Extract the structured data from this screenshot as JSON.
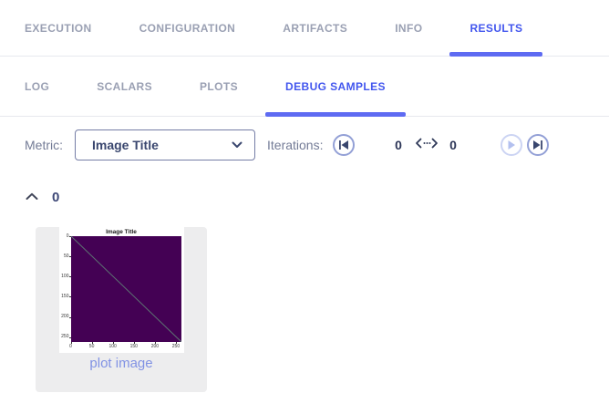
{
  "colors": {
    "accent_text": "#4256ee",
    "accent_underline": "#5e6bf2",
    "tab_inactive": "#9aa0b3",
    "divider": "#e7e8ee",
    "label_gray": "#737b96",
    "value_navy": "#2c3557",
    "card_bg": "#ededee",
    "caption_blue": "#8192e4"
  },
  "primary_tabs": {
    "items": [
      {
        "label": "EXECUTION",
        "active": false
      },
      {
        "label": "CONFIGURATION",
        "active": false
      },
      {
        "label": "ARTIFACTS",
        "active": false
      },
      {
        "label": "INFO",
        "active": false
      },
      {
        "label": "RESULTS",
        "active": true
      }
    ]
  },
  "secondary_tabs": {
    "items": [
      {
        "label": "LOG",
        "active": false
      },
      {
        "label": "SCALARS",
        "active": false
      },
      {
        "label": "PLOTS",
        "active": false
      },
      {
        "label": "DEBUG SAMPLES",
        "active": true
      }
    ]
  },
  "toolbar": {
    "metric_label": "Metric:",
    "metric_dropdown": {
      "value": "Image Title",
      "icon": "chevron-down-icon"
    },
    "iterations_label": "Iterations:",
    "min_value": "0",
    "max_value": "0",
    "range_icon": "dotted-left-right-arrow-icon",
    "buttons": [
      {
        "name": "first-iteration",
        "icon": "skip-previous-icon",
        "enabled": true
      },
      {
        "name": "next-iteration",
        "icon": "play-next-icon",
        "enabled": false
      },
      {
        "name": "last-iteration",
        "icon": "skip-next-icon",
        "enabled": true
      }
    ]
  },
  "content": {
    "group": {
      "collapse_icon": "chevron-up-icon",
      "label": "0"
    },
    "sample": {
      "caption": "plot image"
    }
  },
  "chart_data": {
    "type": "heatmap",
    "title": "Image Title",
    "x_ticks": [
      0,
      50,
      100,
      150,
      200,
      250
    ],
    "y_ticks": [
      0,
      50,
      100,
      150,
      200,
      250
    ],
    "x_range": [
      0,
      262
    ],
    "y_range": [
      0,
      262
    ],
    "field_color": "#440154",
    "diagonal_line": {
      "from": [
        0,
        0
      ],
      "to": [
        262,
        262
      ],
      "color": "#5c7272"
    },
    "grid": false,
    "legend": false
  }
}
